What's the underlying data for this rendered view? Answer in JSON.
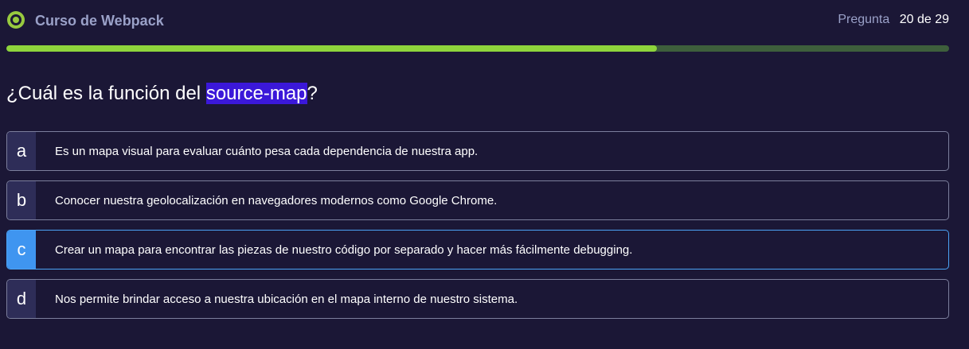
{
  "header": {
    "course_title": "Curso de Webpack",
    "progress_label": "Pregunta",
    "progress_value": "20 de 29",
    "progress_fraction": 0.69,
    "logo_icon": "platzi-logo-icon"
  },
  "question": {
    "prefix": "¿Cuál es la función del ",
    "highlight": "source-map",
    "suffix": "?"
  },
  "options": [
    {
      "letter": "a",
      "text": "Es un mapa visual para evaluar cuánto pesa cada dependencia de nuestra app."
    },
    {
      "letter": "b",
      "text": "Conocer nuestra geolocalización en navegadores modernos como Google Chrome."
    },
    {
      "letter": "c",
      "text": "Crear un mapa para encontrar las piezas de nuestro código por separado y hacer más fácilmente debugging."
    },
    {
      "letter": "d",
      "text": "Nos permite brindar acceso a nuestra ubicación en el mapa interno de nuestro sistema."
    }
  ],
  "selected_option": "c",
  "colors": {
    "background": "#1b1736",
    "progress_fill": "#8ed43c",
    "progress_track": "#3e5f3c",
    "highlight": "#3b18d9",
    "selected_accent": "#3f95f0"
  }
}
